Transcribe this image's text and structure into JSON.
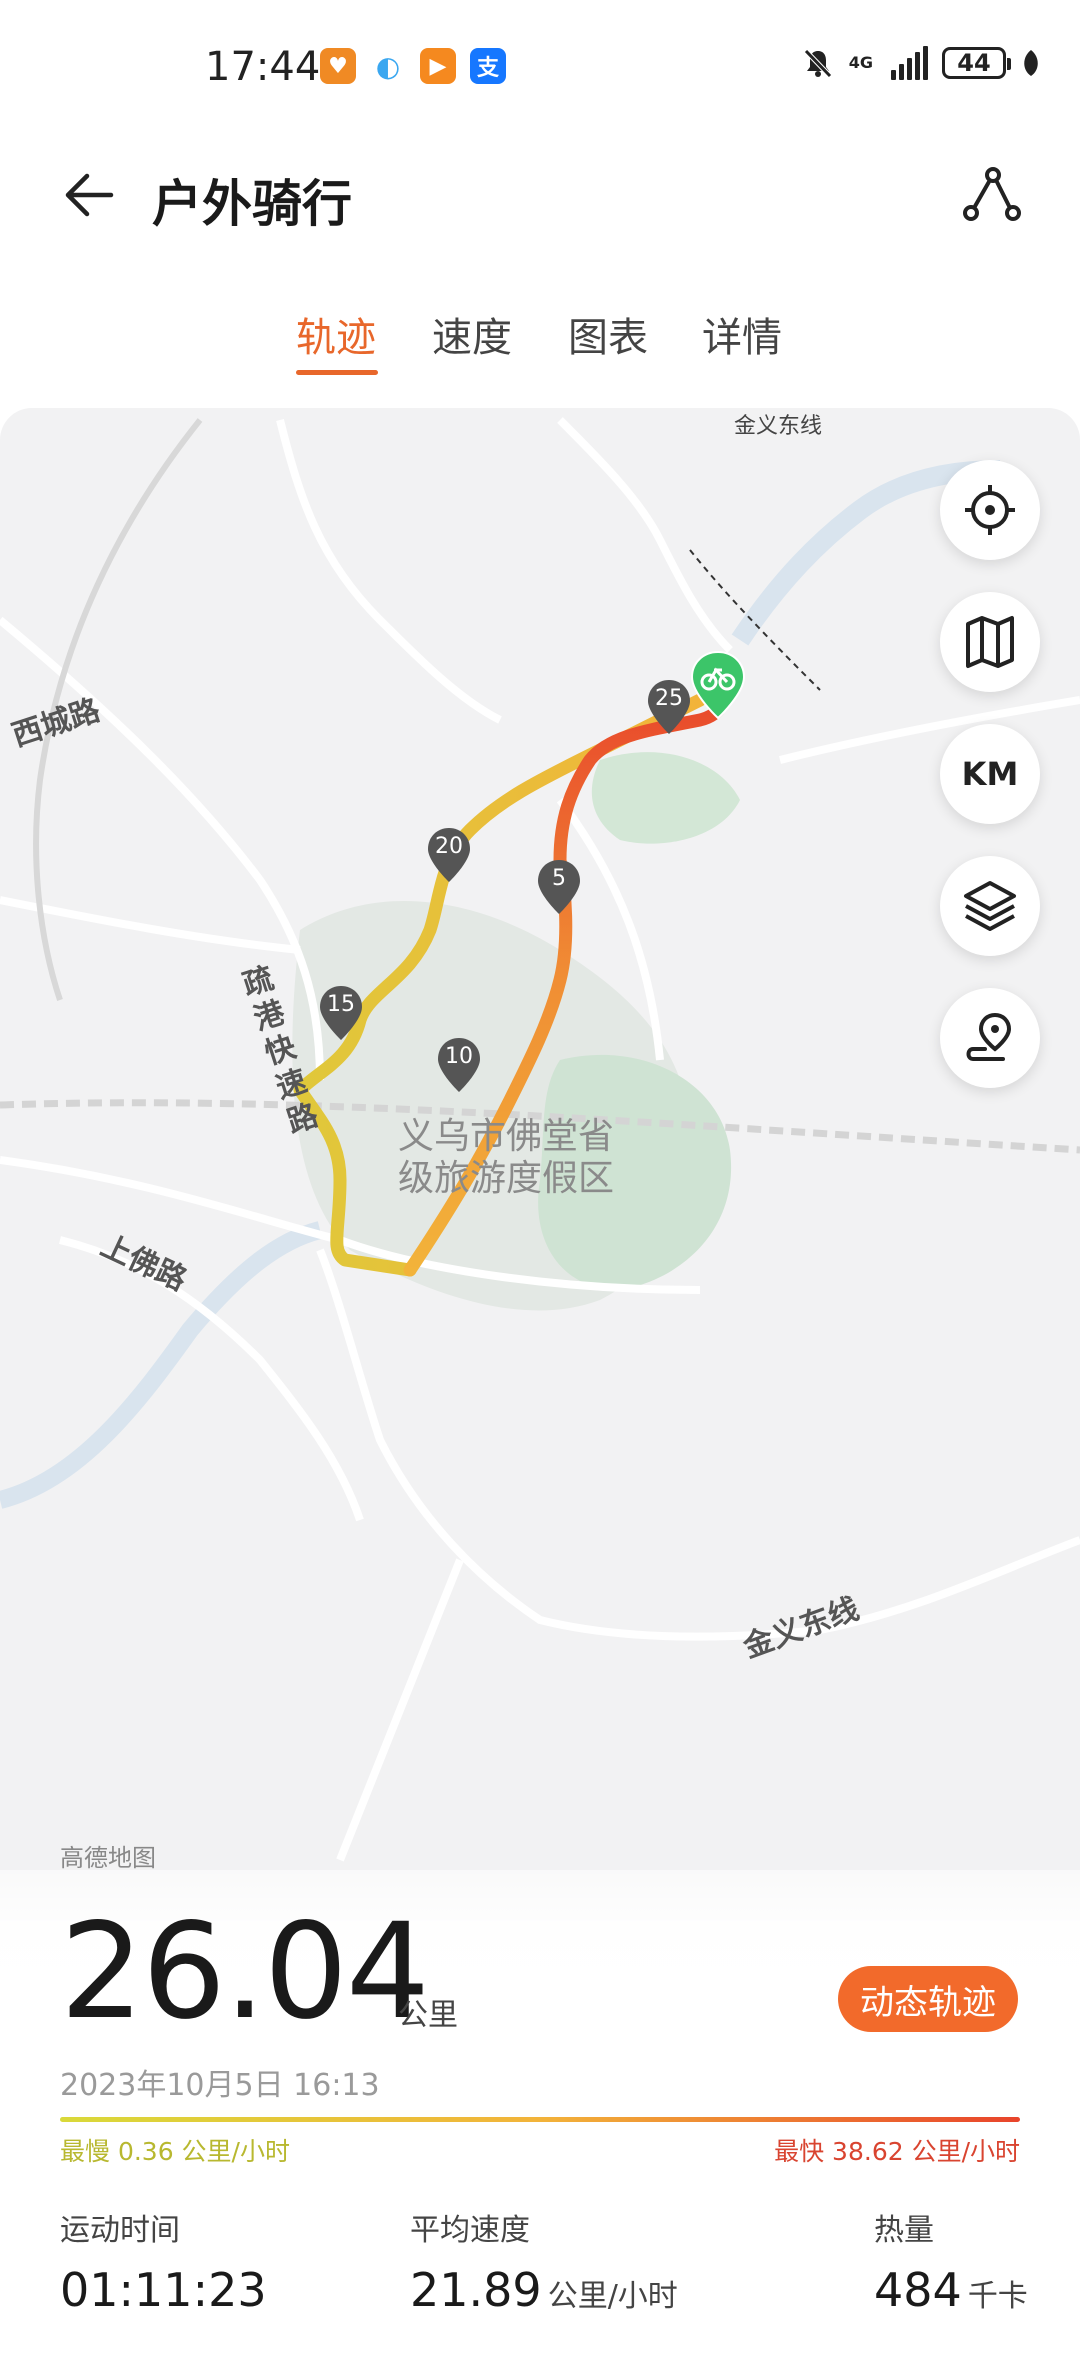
{
  "status_bar": {
    "time": "17:44",
    "network": "4G",
    "battery": "44",
    "apps": [
      {
        "icon": "health-app-icon",
        "color": "#f08a24",
        "glyph": "♥"
      },
      {
        "icon": "blue-app-icon",
        "color": "#3aa7f0",
        "glyph": "◐"
      },
      {
        "icon": "video-app-icon",
        "color": "#f5891f",
        "glyph": "▶"
      },
      {
        "icon": "alipay-icon",
        "color": "#1677ff",
        "glyph": "支"
      }
    ]
  },
  "header": {
    "title": "户外骑行"
  },
  "tabs": [
    {
      "label": "轨迹",
      "active": true
    },
    {
      "label": "速度",
      "active": false
    },
    {
      "label": "图表",
      "active": false
    },
    {
      "label": "详情",
      "active": false
    }
  ],
  "map": {
    "labels": {
      "jinyi_top": "金义东线",
      "xicheng": "西城路",
      "shugang": "疏港快速路",
      "shangfo": "上佛路",
      "jinyi_bottom": "金义东线",
      "area_line1": "义乌市佛堂省",
      "area_line2": "级旅游度假区",
      "attribution": "高德地图"
    },
    "markers": [
      "5",
      "10",
      "15",
      "20",
      "25"
    ],
    "controls": {
      "locate": "locate-icon",
      "map_type": "map-icon",
      "km": "KM",
      "layers": "layers-icon",
      "route_point": "route-pin-icon"
    }
  },
  "summary": {
    "distance": "26.04",
    "distance_unit": "公里",
    "date": "2023年10月5日 16:13",
    "dynamic_track_button": "动态轨迹",
    "slowest": "最慢 0.36 公里/小时",
    "fastest": "最快 38.62 公里/小时"
  },
  "stats": [
    {
      "label": "运动时间",
      "value": "01:11:23",
      "unit": ""
    },
    {
      "label": "平均速度",
      "value": "21.89",
      "unit": "公里/小时"
    },
    {
      "label": "热量",
      "value": "484",
      "unit": "千卡"
    }
  ],
  "colors": {
    "accent": "#e8672b",
    "button": "#f26a2b",
    "slow": "#d9d93a",
    "fast": "#e8442b"
  }
}
